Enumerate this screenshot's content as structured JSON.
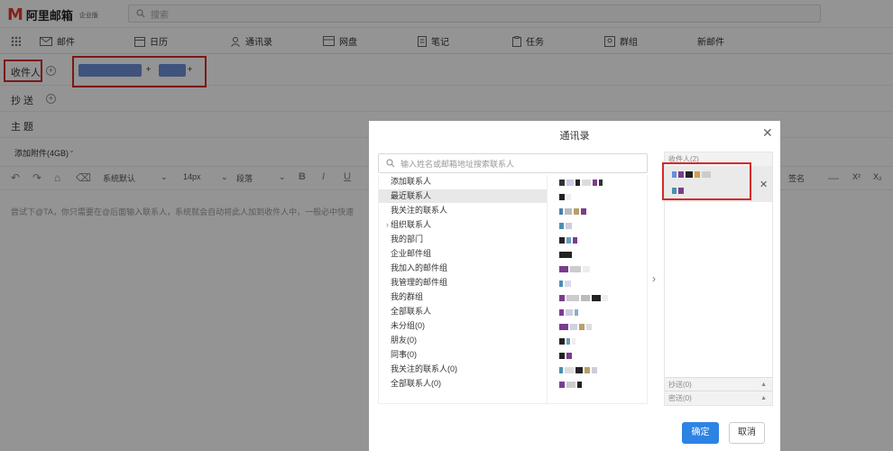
{
  "app": {
    "logo_letter": "M",
    "logo_name": "阿里邮箱",
    "edition": "企业版",
    "brand_color": "#e23a2e",
    "search_placeholder": "搜索"
  },
  "nav": {
    "items": [
      {
        "label": "邮件",
        "icon": "mail-icon"
      },
      {
        "label": "日历",
        "icon": "calendar-icon"
      },
      {
        "label": "通讯录",
        "icon": "contacts-icon"
      },
      {
        "label": "网盘",
        "icon": "drive-icon"
      },
      {
        "label": "笔记",
        "icon": "note-icon"
      },
      {
        "label": "任务",
        "icon": "task-icon"
      },
      {
        "label": "群组",
        "icon": "group-icon"
      },
      {
        "label": "新邮件",
        "icon": ""
      }
    ]
  },
  "compose": {
    "to_label": "收件人",
    "cc_label": "抄 送",
    "subject_label": "主 题",
    "attachment_label": "添加附件(4GB)",
    "font_family": "系统默认",
    "font_size": "14px",
    "paragraph": "段落",
    "signature": "签名",
    "body_placeholder": "尝试下@TA，你只需要在@后面输入联系人，系统就会自动将此人加到收件人中，一般必中快速"
  },
  "dialog": {
    "title": "通讯录",
    "search_placeholder": "输入姓名或邮箱地址搜索联系人",
    "groups": [
      "添加联系人",
      "最近联系人",
      "我关注的联系人",
      "组织联系人",
      "我的部门",
      "企业邮件组",
      "我加入的邮件组",
      "我管理的邮件组",
      "我的群组",
      "全部联系人",
      "未分组(0)",
      "朋友(0)",
      "同事(0)",
      "我关注的联系人(0)",
      "全部联系人(0)"
    ],
    "selected_group_index": 1,
    "recipients_header": "收件人(2)",
    "cc_header": "抄送(0)",
    "bcc_header": "密送(0)",
    "ok_label": "确定",
    "cancel_label": "取消",
    "accent_color": "#2d83e3"
  }
}
